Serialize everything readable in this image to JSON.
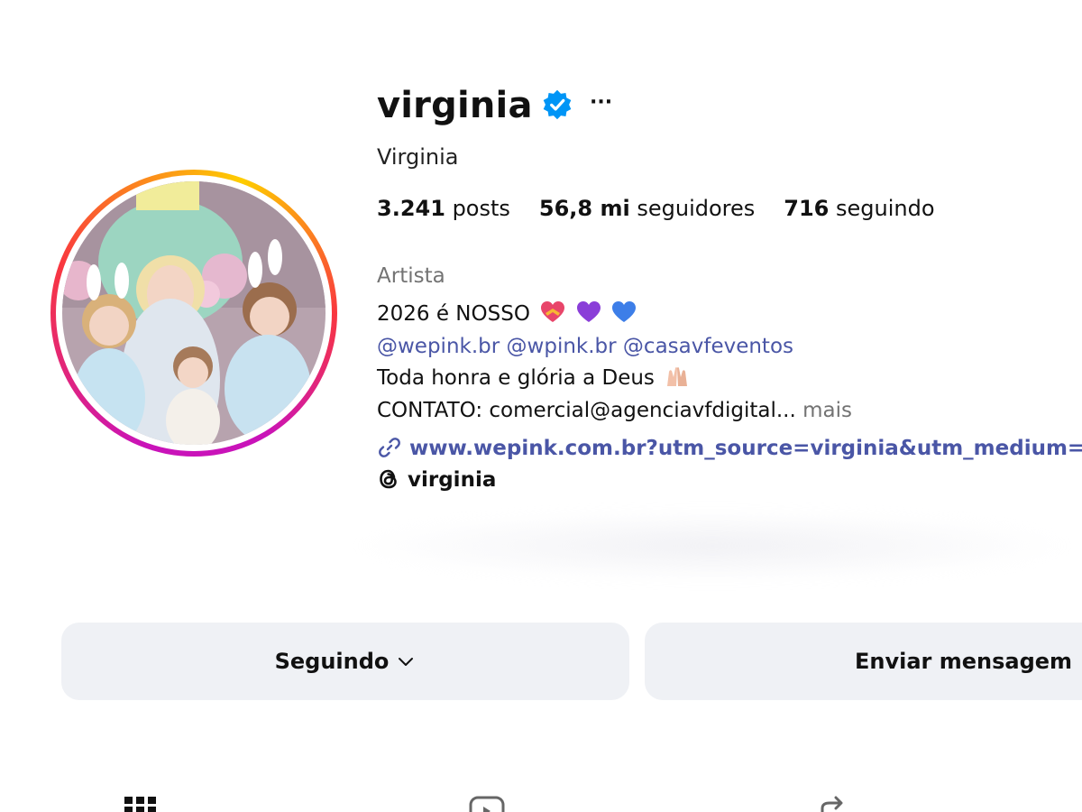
{
  "profile": {
    "username": "virginia",
    "full_name": "Virginia",
    "verified_icon": "verified-badge-icon",
    "more_icon": "···",
    "stats": [
      {
        "count": "3.241",
        "label": "posts"
      },
      {
        "count": "56,8 mi",
        "label": "seguidores"
      },
      {
        "count": "716",
        "label": "seguindo"
      }
    ],
    "category": "Artista",
    "bio": {
      "line1": "2026 é NOSSO",
      "line1_emojis": [
        "heart-with-ribbon-icon",
        "purple-heart-icon",
        "blue-heart-icon"
      ],
      "mentions": [
        "@wepink.br",
        "@wpink.br",
        "@casavfeventos"
      ],
      "line3": "Toda honra e glória a Deus",
      "line3_emoji": "raised-hands-icon",
      "line4": "CONTATO: comercial@agenciavfdigital...",
      "more_label": "mais"
    },
    "link": "www.wepink.com.br?utm_source=virginia&utm_medium=in",
    "threads_handle": "virginia"
  },
  "actions": {
    "following_label": "Seguindo",
    "message_label": "Enviar mensagem"
  },
  "tabs": [
    "grid-icon",
    "reels-icon",
    "tagged-icon"
  ],
  "colors": {
    "link": "#4a56a6",
    "verified": "#0095f6",
    "button_bg": "#eff1f5",
    "muted": "#737373"
  }
}
